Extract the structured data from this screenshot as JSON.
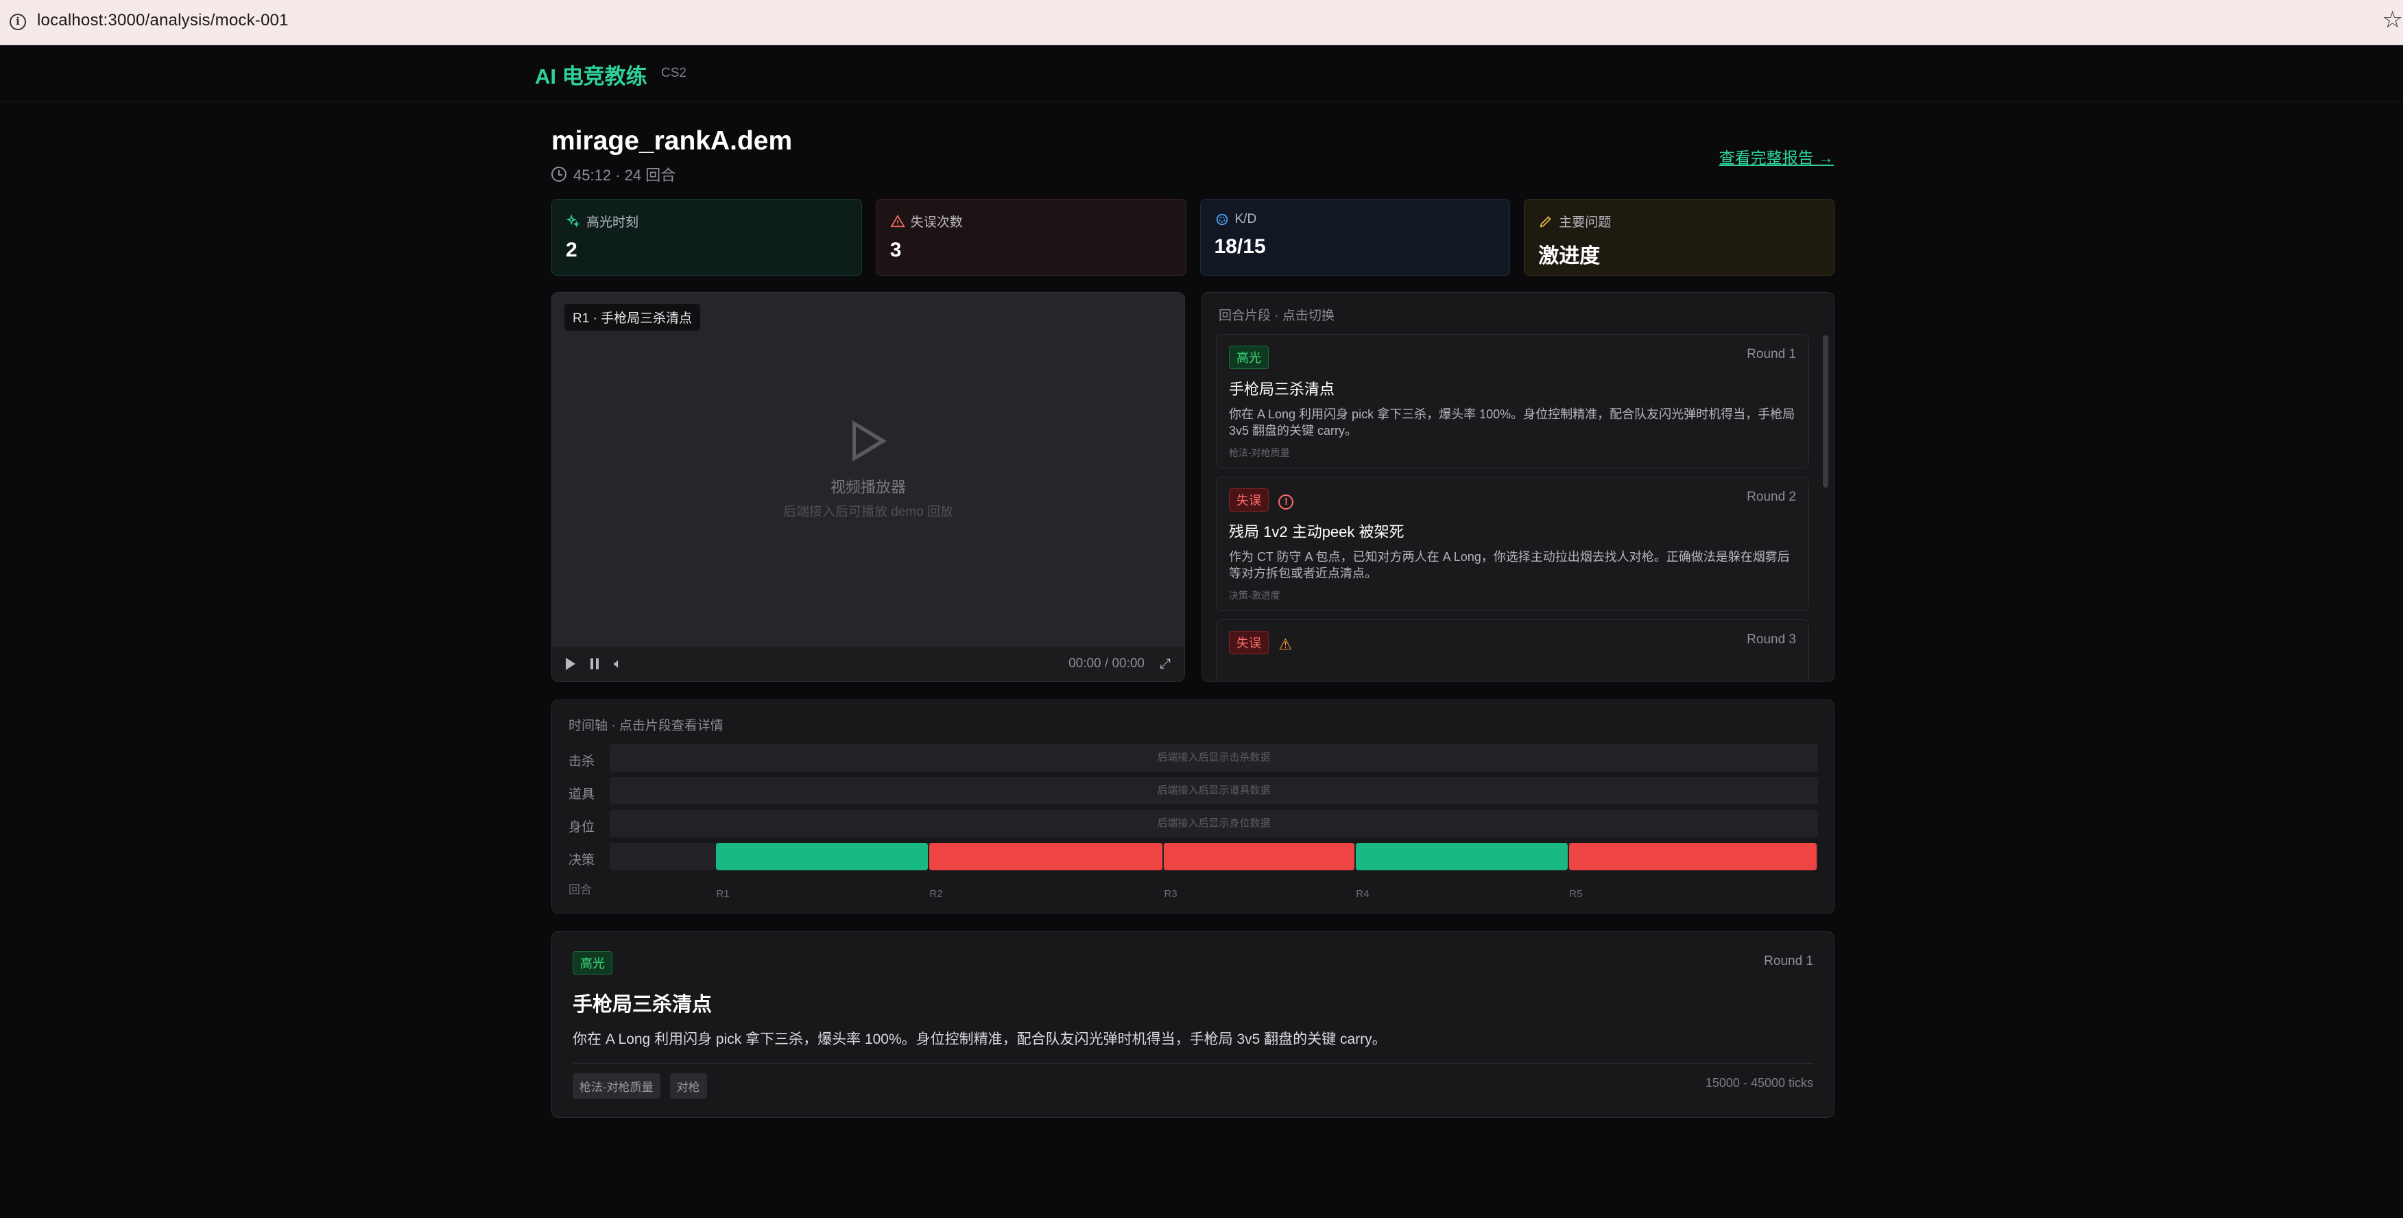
{
  "browser": {
    "url": "localhost:3000/analysis/mock-001"
  },
  "header": {
    "brand": "AI 电竞教练",
    "game": "CS2"
  },
  "match": {
    "title": "mirage_rankA.dem",
    "meta": "45:12 · 24 回合",
    "report_link": "查看完整报告 →"
  },
  "stats": [
    {
      "label": "高光时刻",
      "value": "2",
      "icon": "sparkles-icon",
      "color": "#2fd39a"
    },
    {
      "label": "失误次数",
      "value": "3",
      "icon": "warning-icon",
      "color": "#ff6b6b"
    },
    {
      "label": "K/D",
      "value": "18/15",
      "icon": "crosshair-icon",
      "color": "#5aa9ff"
    },
    {
      "label": "主要问题",
      "value": "激进度",
      "icon": "pencil-icon",
      "color": "#f5c24a"
    }
  ],
  "video": {
    "tag": "R1 · 手枪局三杀清点",
    "title": "视频播放器",
    "subtitle": "后端接入后可播放 demo 回放",
    "time": "00:00 / 00:00"
  },
  "clips": {
    "header": "回合片段 · 点击切换",
    "items": [
      {
        "badge": "高光",
        "round": "Round 1",
        "title": "手枪局三杀清点",
        "desc": "你在 A Long 利用闪身 pick 拿下三杀，爆头率 100%。身位控制精准，配合队友闪光弹时机得当，手枪局 3v5 翻盘的关键 carry。",
        "tag": "枪法-对枪质量"
      },
      {
        "badge": "失误",
        "round": "Round 2",
        "title": "残局 1v2 主动peek 被架死",
        "desc": "作为 CT 防守 A 包点，已知对方两人在 A Long，你选择主动拉出烟去找人对枪。正确做法是躲在烟雾后等对方拆包或者近点清点。",
        "tag": "决策-激进度"
      },
      {
        "badge": "失误",
        "round": "Round 3",
        "title": "",
        "desc": "",
        "tag": ""
      }
    ]
  },
  "timeline": {
    "header": "时间轴 · 点击片段查看详情",
    "rows": [
      {
        "label": "击杀",
        "placeholder": "后端接入后显示击杀数据"
      },
      {
        "label": "道具",
        "placeholder": "后端接入后显示道具数据"
      },
      {
        "label": "身位",
        "placeholder": "后端接入后显示身位数据"
      }
    ],
    "decision_label": "决策",
    "round_label": "回合",
    "segments": [
      {
        "round": "R1",
        "result": "highlight",
        "start": 0.0,
        "end": 0.3
      },
      {
        "round": "R2",
        "result": "mistake",
        "start": 0.3,
        "end": 0.63
      },
      {
        "round": "R3",
        "result": "mistake",
        "start": 0.63,
        "end": 0.9
      },
      {
        "round": "R4",
        "result": "highlight",
        "start": 0.9,
        "end": 1.2
      },
      {
        "round": "R5",
        "result": "mistake",
        "start": 1.2,
        "end": 1.55
      }
    ],
    "range": [
      -0.15,
      1.55
    ],
    "colors": {
      "highlight": "#19b984",
      "mistake": "#ef4444"
    }
  },
  "detail": {
    "badge": "高光",
    "round": "Round 1",
    "title": "手枪局三杀清点",
    "desc": "你在 A Long 利用闪身 pick 拿下三杀，爆头率 100%。身位控制精准，配合队友闪光弹时机得当，手枪局 3v5 翻盘的关键 carry。",
    "tags": [
      "枪法-对枪质量",
      "对枪"
    ],
    "ticks": "15000 - 45000 ticks"
  }
}
